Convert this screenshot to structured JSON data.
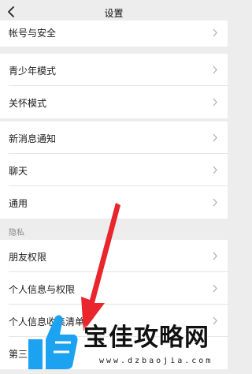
{
  "nav": {
    "title": "设置"
  },
  "groups": {
    "account": {
      "label": "帐号与安全"
    },
    "youth": {
      "label": "青少年模式"
    },
    "care": {
      "label": "关怀模式"
    },
    "notify": {
      "label": "新消息通知"
    },
    "chat": {
      "label": "聊天"
    },
    "general": {
      "label": "通用"
    }
  },
  "privacy": {
    "header": "隐私",
    "friends": "朋友权限",
    "personal_info": "个人信息与权限",
    "collection_list": "个人信息收集清单",
    "third_party": "第三方"
  },
  "watermark": {
    "brand": "宝佳攻略网",
    "url": "www.dzbaojia.com"
  },
  "colors": {
    "accent_arrow": "#e8262b",
    "logo_blue": "#1ba3f2",
    "background": "#ededed"
  }
}
